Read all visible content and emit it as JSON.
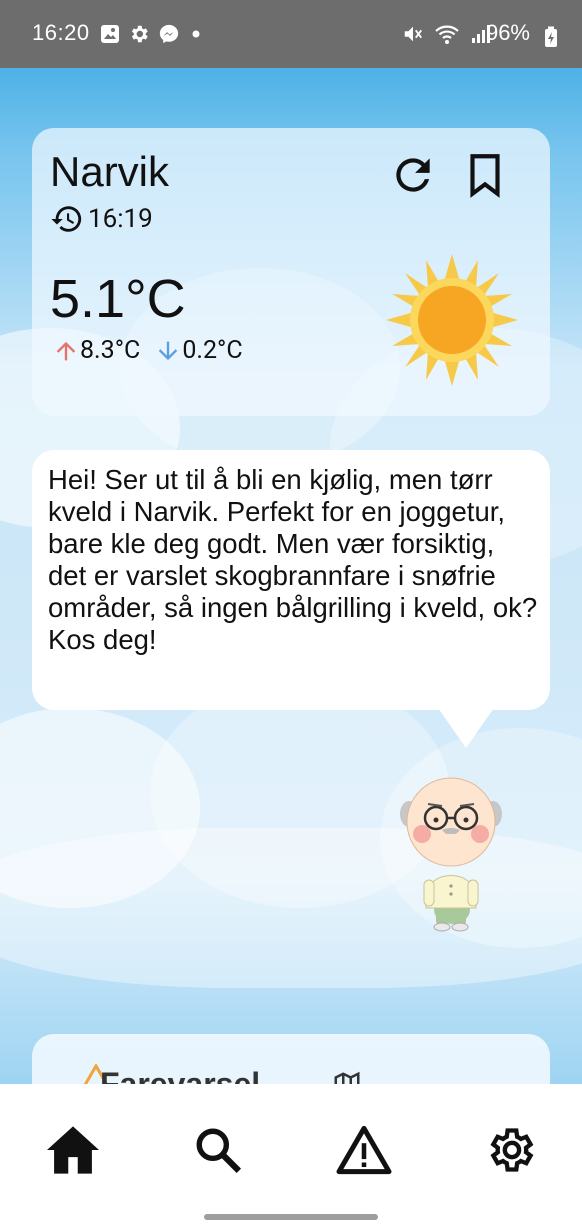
{
  "status_bar": {
    "time": "16:20",
    "battery_percent": "96%",
    "left_icons": [
      "image-icon",
      "settings-gear-icon",
      "messenger-icon",
      "dot-icon"
    ],
    "right_icons": [
      "mute-vibrate-icon",
      "wifi-icon",
      "signal-icon",
      "battery-charging-icon"
    ]
  },
  "weather": {
    "city": "Narvik",
    "updated_time": "16:19",
    "temperature": "5.1°C",
    "high": "8.3°C",
    "low": "0.2°C",
    "condition_icon": "sun-icon",
    "high_color": "#e57368",
    "low_color": "#5b9fe0"
  },
  "message": {
    "text": "Hei! Ser ut til å bli en kjølig, men tørr kveld i Narvik. Perfekt for en joggetur, bare kle deg godt. Men vær forsiktig, det er varslet skogbrannfare i snøfrie områder, så ingen bålgrilling i kveld, ok? Kos deg!"
  },
  "forecast": {
    "title": "Farevarsel"
  },
  "nav": {
    "items": [
      "home-icon",
      "search-icon",
      "warning-icon",
      "settings-icon"
    ]
  }
}
